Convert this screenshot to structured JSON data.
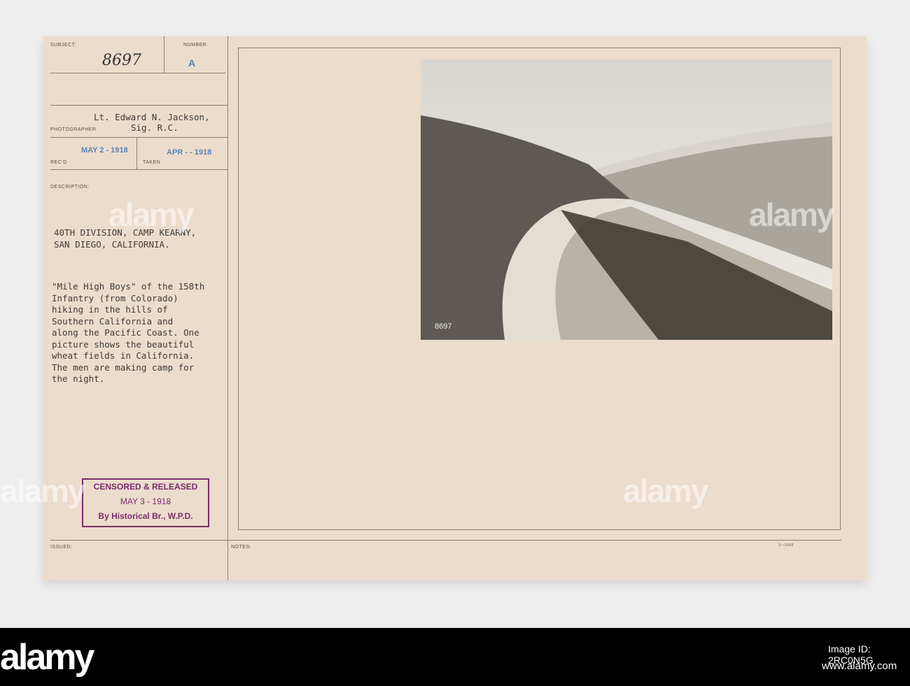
{
  "card": {
    "subject_label": "SUBJECT:",
    "subject_number": "8697",
    "number_label": "NUMBER",
    "number_value": "A",
    "photographer_name": "Lt. Edward N. Jackson,",
    "photographer_unit": "Sig. R.C.",
    "photographer_label": "PHOTOGRAPHER",
    "received_label": "REC'D",
    "received_date": "MAY 2 - 1918",
    "taken_label": "TAKEN",
    "taken_date": "APR - - 1918",
    "description_label": "DESCRIPTION:",
    "location": "40TH DIVISION, CAMP KEARNY,\nSAN DIEGO, CALIFORNIA.",
    "description": "\"Mile High Boys\" of the 158th\nInfantry (from Colorado)\nhiking in the hills of\nSouthern California and\nalong the Pacific Coast. One\npicture shows the beautiful\nwheat fields in California.\nThe men are making camp for\nthe night.",
    "stamp": {
      "line1": "CENSORED & RELEASED",
      "line2": "MAY 3 - 1918",
      "line3": "By Historical Br., W.P.D."
    },
    "issued_label": "ISSUED:",
    "notes_label": "NOTES:",
    "form_code": "3—2005",
    "photo_number": "8697"
  },
  "watermark": "alamy",
  "footer": {
    "logo": "alamy",
    "image_id": "Image ID: 2RC0N5G",
    "url": "www.alamy.com"
  }
}
